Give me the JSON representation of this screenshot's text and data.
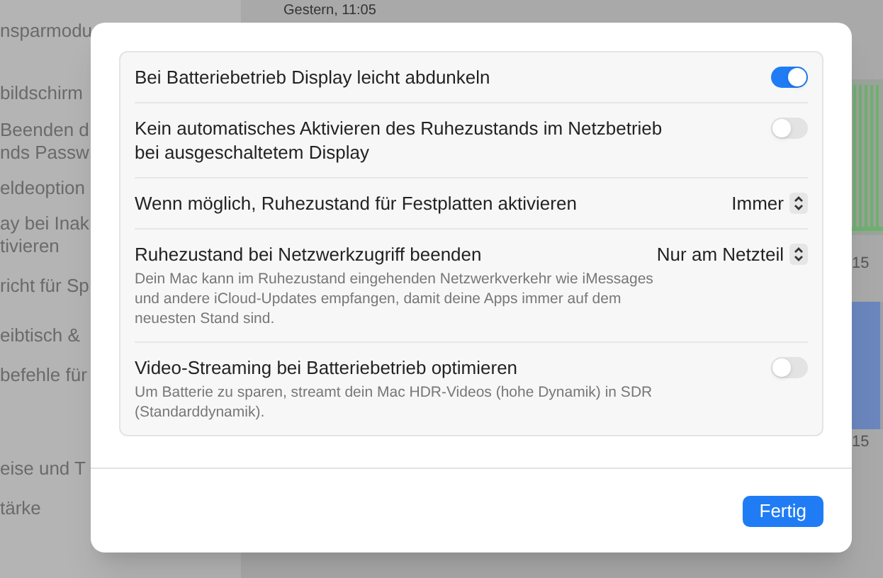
{
  "background": {
    "sidebar_items": [
      {
        "label": "nsparmodu"
      },
      {
        "label": "bildschirm"
      },
      {
        "label": "Beenden d\nnds Passw"
      },
      {
        "label": "eldeoption"
      },
      {
        "label": "ay bei Inak\ntivieren"
      },
      {
        "label": "richt für Sp"
      },
      {
        "label": "eibtisch &"
      },
      {
        "label": "befehle für"
      },
      {
        "label": "eise und T"
      },
      {
        "label": "tärke"
      }
    ],
    "status": {
      "time": "Gestern, 11:05"
    },
    "chart_labels": [
      "15",
      "15"
    ]
  },
  "dialog": {
    "settings": [
      {
        "kind": "toggle",
        "label": "Bei Batteriebetrieb Display leicht abdunkeln",
        "on": true
      },
      {
        "kind": "toggle",
        "label": "Kein automatisches Aktivieren des Ruhezustands im Netzbetrieb bei ausgeschaltetem Display",
        "on": false
      },
      {
        "kind": "popup",
        "label": "Wenn möglich, Ruhezustand für Festplatten aktivieren",
        "value": "Immer"
      },
      {
        "kind": "popup",
        "label": "Ruhezustand bei Netzwerkzugriff beenden",
        "value": "Nur am Netzteil",
        "description": "Dein Mac kann im Ruhezustand eingehenden Netzwerkverkehr wie iMessages und andere iCloud-Updates empfangen, damit deine Apps immer auf dem neuesten Stand sind."
      },
      {
        "kind": "toggle",
        "label": "Video-Streaming bei Batteriebetrieb optimieren",
        "on": false,
        "description": "Um Batterie zu sparen, streamt dein Mac HDR-Videos (hohe Dynamik) in SDR (Standarddynamik)."
      }
    ],
    "done_button": "Fertig"
  }
}
